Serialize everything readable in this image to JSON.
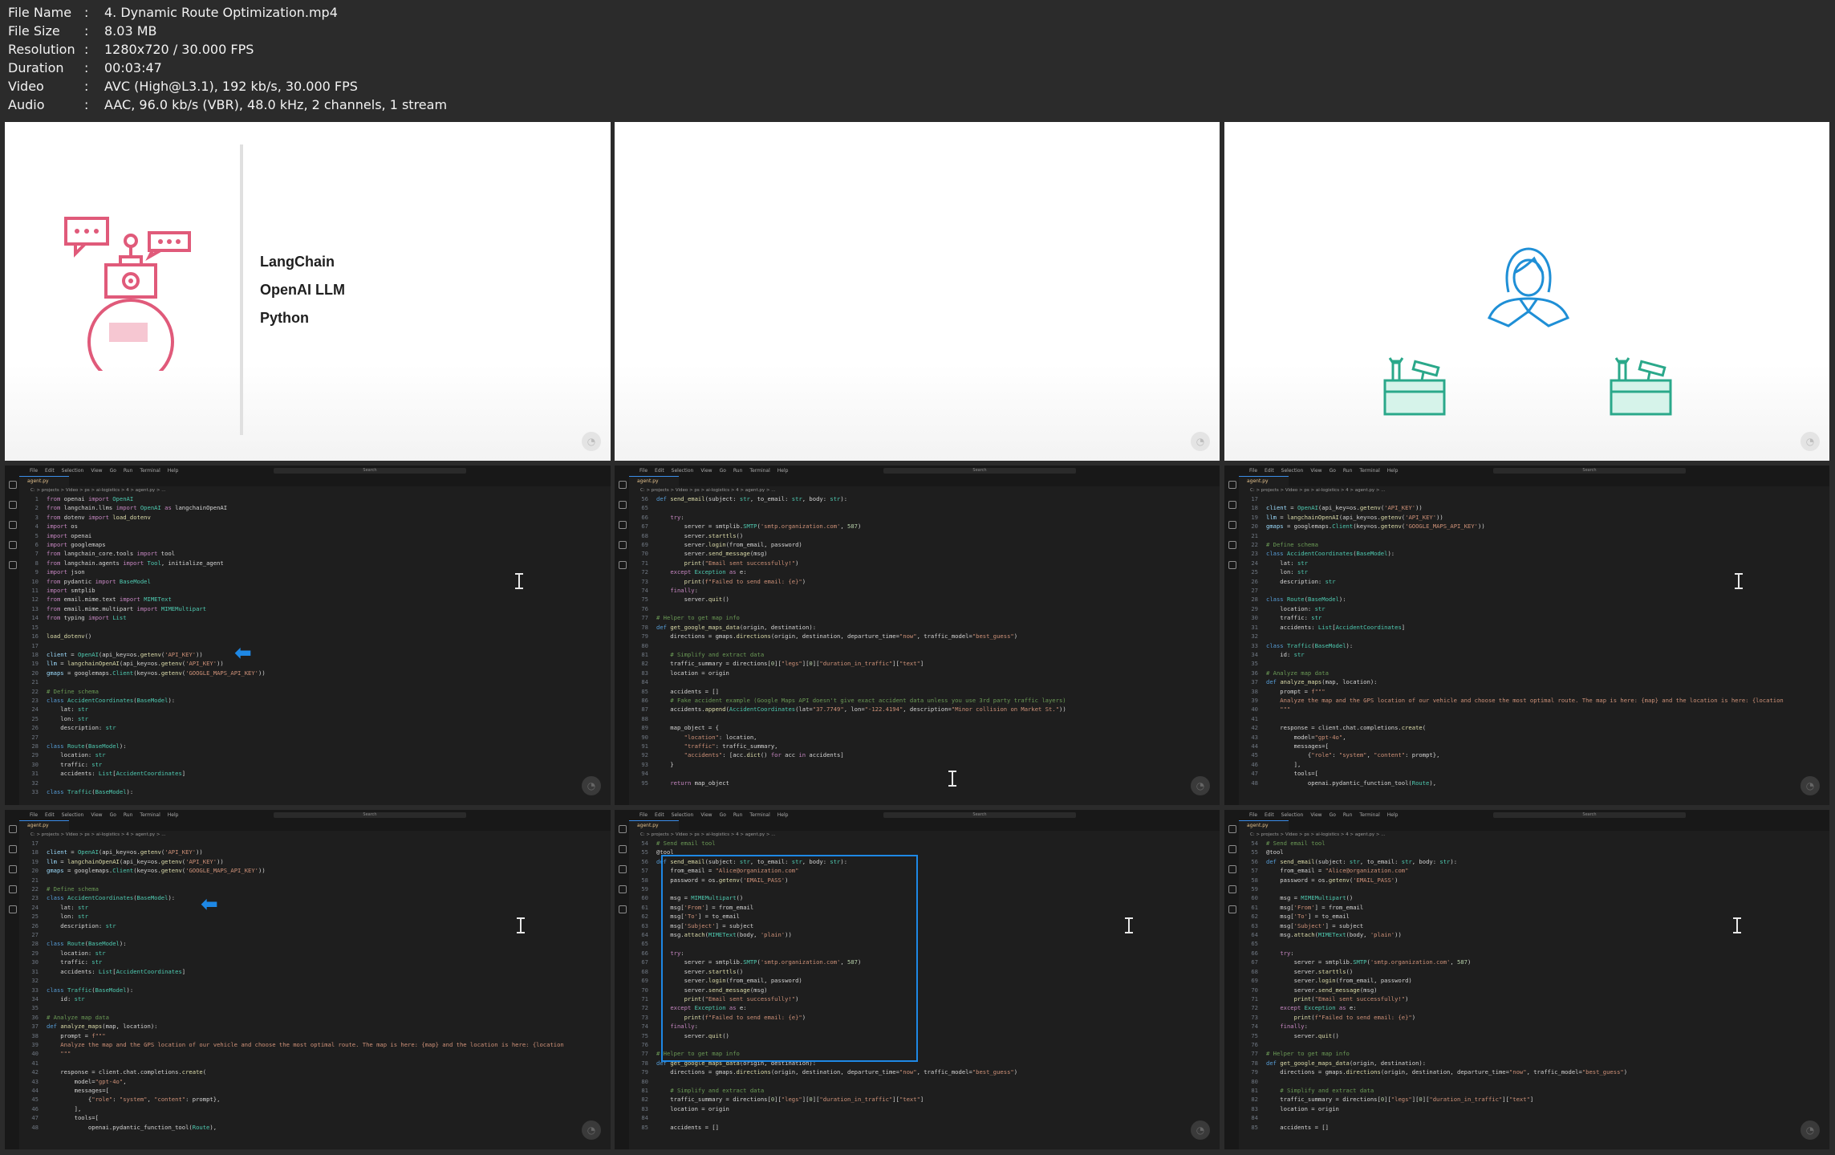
{
  "file_info": [
    {
      "key": "File Name",
      "value": "4. Dynamic Route Optimization.mp4"
    },
    {
      "key": "File Size",
      "value": "8.03 MB"
    },
    {
      "key": "Resolution",
      "value": "1280x720 / 30.000 FPS"
    },
    {
      "key": "Duration",
      "value": "00:03:47"
    },
    {
      "key": "Video",
      "value": "AVC (High@L3.1), 192 kb/s, 30.000 FPS"
    },
    {
      "key": "Audio",
      "value": "AAC, 96.0 kb/s (VBR), 48.0 kHz, 2 channels, 1 stream"
    }
  ],
  "separator": ":",
  "slide1": {
    "items": [
      "LangChain",
      "OpenAI LLM",
      "Python"
    ]
  },
  "editor": {
    "menu": [
      "File",
      "Edit",
      "Selection",
      "View",
      "Go",
      "Run",
      "Terminal",
      "Help"
    ],
    "search": "Search",
    "tab": "agent.py",
    "breadcrumb": "C: > projects > Video > ps > ai-logistics > 4 > agent.py > ..."
  },
  "colors": {
    "accent": "#1e88e5",
    "slide_red": "#e05a7a",
    "slide_teal": "#2aa88a",
    "slide_blue": "#1f8fd6"
  }
}
